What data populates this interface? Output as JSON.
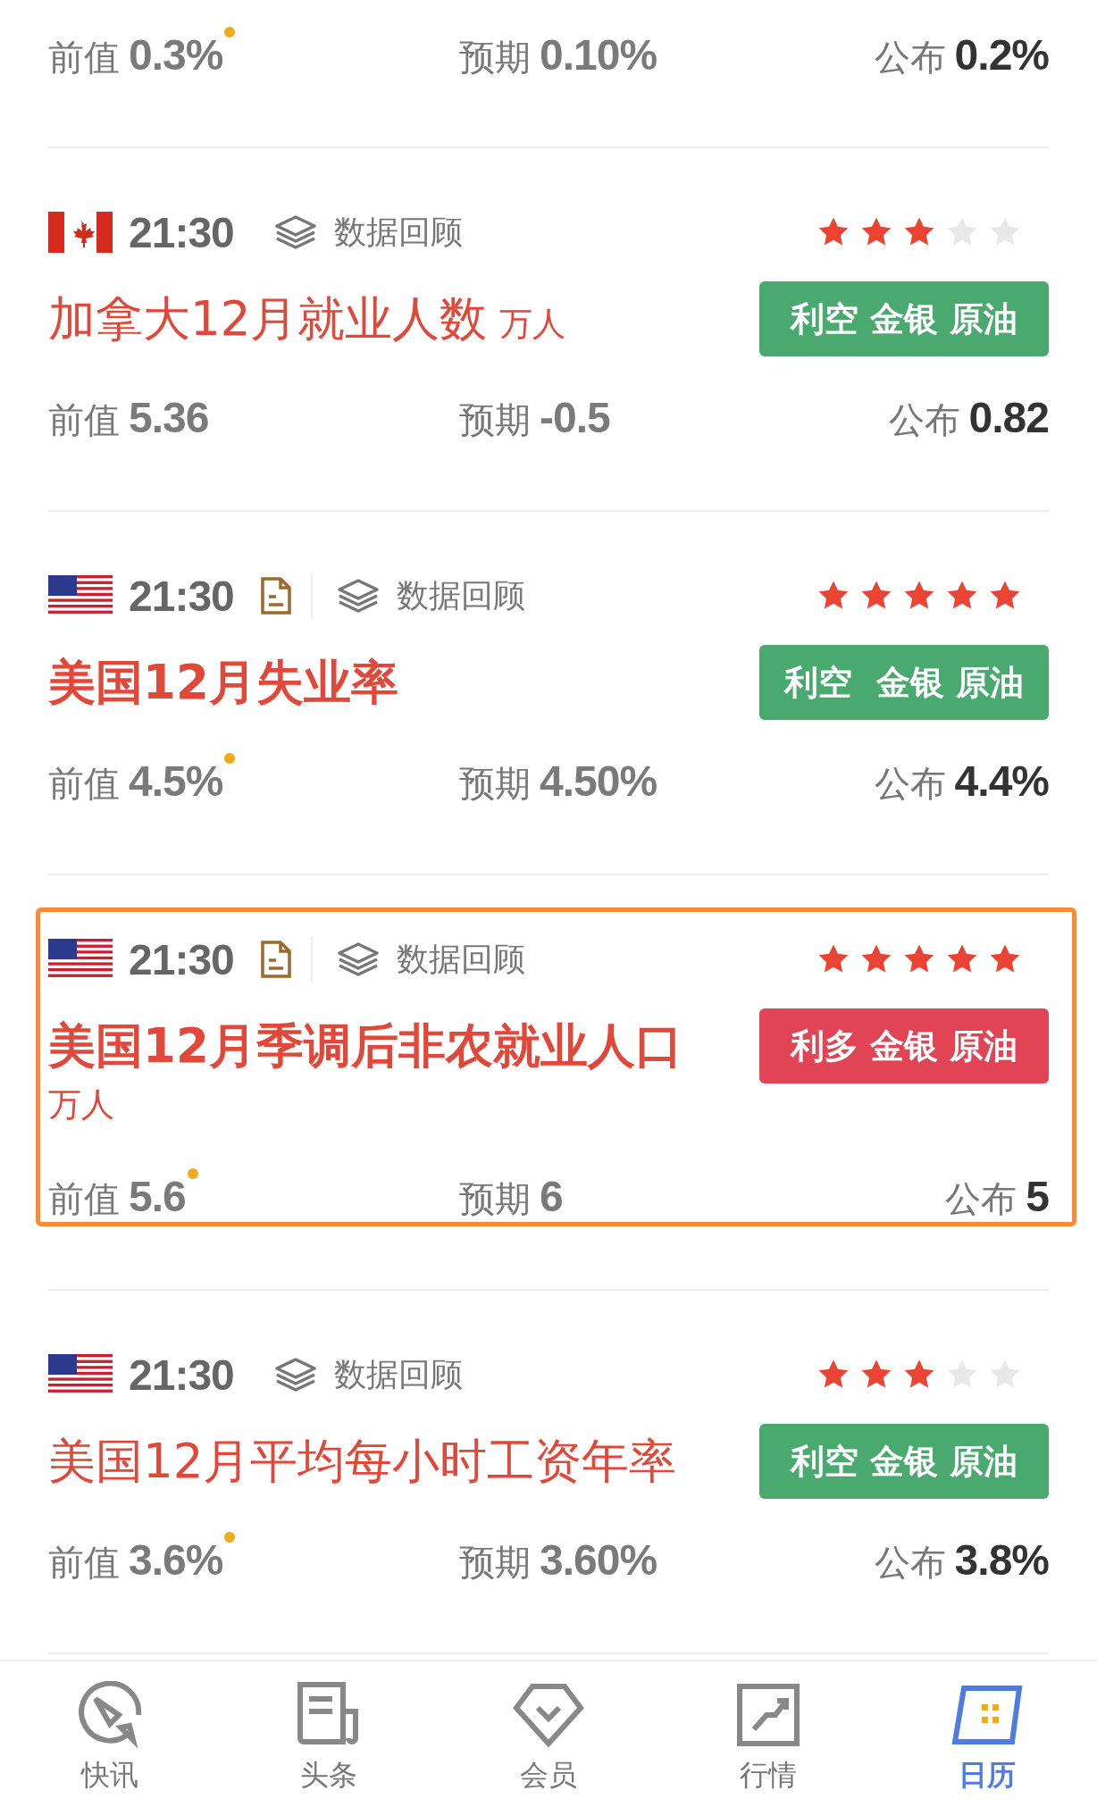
{
  "top_values": {
    "previous": {
      "label": "前值",
      "value": "0.3%",
      "revised": true
    },
    "forecast": {
      "label": "预期",
      "value": "0.10%"
    },
    "actual": {
      "label": "公布",
      "value": "0.2%"
    }
  },
  "events": [
    {
      "kind": "canada",
      "time": "21:30",
      "has_doc": false,
      "review": "数据回顾",
      "stars": 3,
      "title": "加拿大12月就业人数",
      "unit": "万人",
      "emphasized": false,
      "highlighted": false,
      "badge": {
        "kind": "bearish",
        "text": "利空 金银 原油"
      },
      "previous": {
        "label": "前值",
        "value": "5.36",
        "revised": false
      },
      "forecast": {
        "label": "预期",
        "value": "-0.5"
      },
      "actual": {
        "label": "公布",
        "value": "0.82"
      }
    },
    {
      "kind": "usa",
      "time": "21:30",
      "has_doc": true,
      "review": "数据回顾",
      "stars": 5,
      "title": "美国12月失业率",
      "emphasized": true,
      "highlighted": false,
      "badge": {
        "kind": "bearish",
        "text": "利空  金银 原油"
      },
      "previous": {
        "label": "前值",
        "value": "4.5%",
        "revised": true
      },
      "forecast": {
        "label": "预期",
        "value": "4.50%"
      },
      "actual": {
        "label": "公布",
        "value": "4.4%"
      }
    },
    {
      "kind": "usa",
      "time": "21:30",
      "has_doc": true,
      "review": "数据回顾",
      "stars": 5,
      "title": "美国12月季调后非农就业人口",
      "unit": "万人",
      "emphasized": true,
      "highlighted": true,
      "badge": {
        "kind": "bullish",
        "text": "利多 金银 原油"
      },
      "previous": {
        "label": "前值",
        "value": "5.6",
        "revised": true
      },
      "forecast": {
        "label": "预期",
        "value": "6"
      },
      "actual": {
        "label": "公布",
        "value": "5"
      }
    },
    {
      "kind": "usa",
      "time": "21:30",
      "has_doc": false,
      "review": "数据回顾",
      "stars": 3,
      "title": "美国12月平均每小时工资年率",
      "emphasized": false,
      "highlighted": false,
      "badge": {
        "kind": "bearish",
        "text": "利空 金银 原油"
      },
      "previous": {
        "label": "前值",
        "value": "3.6%",
        "revised": true
      },
      "forecast": {
        "label": "预期",
        "value": "3.60%"
      },
      "actual": {
        "label": "公布",
        "value": "3.8%"
      }
    }
  ],
  "nav": [
    {
      "kind": "rocket",
      "label": "快讯",
      "selected": false
    },
    {
      "kind": "newspaper",
      "label": "头条",
      "selected": false
    },
    {
      "kind": "diamond",
      "label": "会员",
      "selected": false
    },
    {
      "kind": "chart",
      "label": "行情",
      "selected": false
    },
    {
      "kind": "calendar",
      "label": "日历",
      "selected": true
    }
  ]
}
